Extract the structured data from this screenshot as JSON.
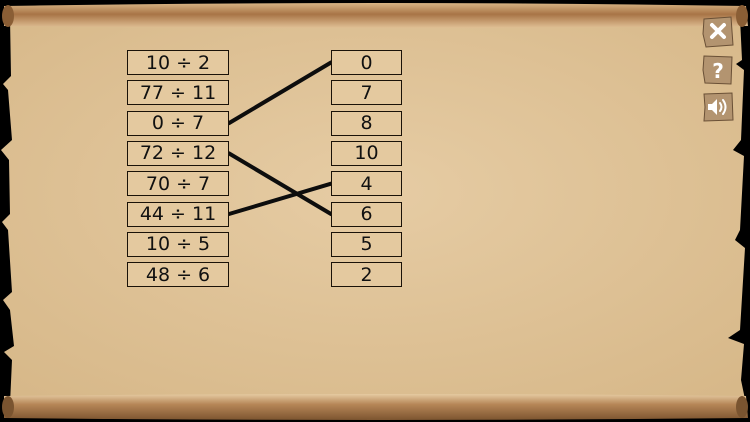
{
  "left_items": [
    "10 ÷ 2",
    "77 ÷ 11",
    "0 ÷ 7",
    "72 ÷ 12",
    "70 ÷ 7",
    "44 ÷ 11",
    "10 ÷ 5",
    "48 ÷ 6"
  ],
  "right_items": [
    "0",
    "7",
    "8",
    "10",
    "4",
    "6",
    "5",
    "2"
  ],
  "connections": [
    {
      "from": 2,
      "to": 0
    },
    {
      "from": 3,
      "to": 5
    },
    {
      "from": 5,
      "to": 4
    }
  ],
  "buttons": {
    "close": "close-icon",
    "help": "help-icon",
    "sound": "speaker-icon"
  },
  "colors": {
    "paper": "#e2c69c",
    "roll": "#b98c5b",
    "line": "#0d0d0d"
  }
}
